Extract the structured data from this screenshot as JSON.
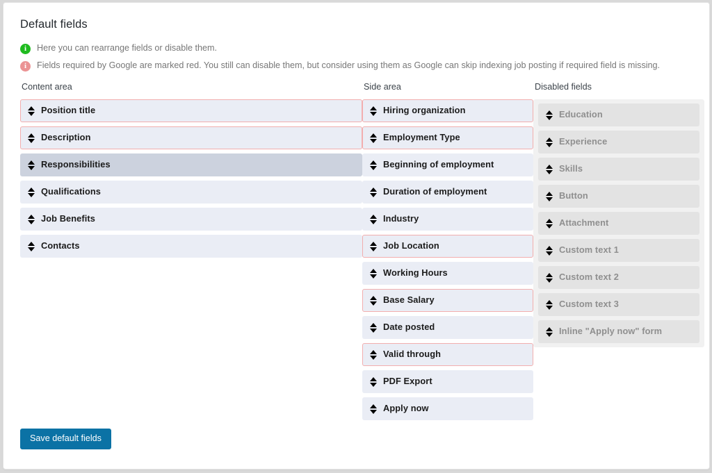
{
  "page": {
    "title": "Default fields"
  },
  "notices": [
    {
      "icon": "info-icon-green",
      "tone": "green",
      "glyph": "i",
      "text": "Here you can rearrange fields or disable them."
    },
    {
      "icon": "info-icon-red",
      "tone": "red",
      "glyph": "i",
      "text": "Fields required by Google are marked red. You still can disable them, but consider using them as Google can skip indexing job posting if required field is missing."
    }
  ],
  "columns": {
    "content": {
      "heading": "Content area",
      "items": [
        {
          "label": "Position title",
          "required": true,
          "active": false
        },
        {
          "label": "Description",
          "required": true,
          "active": false
        },
        {
          "label": "Responsibilities",
          "required": false,
          "active": true
        },
        {
          "label": "Qualifications",
          "required": false,
          "active": false
        },
        {
          "label": "Job Benefits",
          "required": false,
          "active": false
        },
        {
          "label": "Contacts",
          "required": false,
          "active": false
        }
      ]
    },
    "side": {
      "heading": "Side area",
      "items": [
        {
          "label": "Hiring organization",
          "required": true,
          "active": false
        },
        {
          "label": "Employment Type",
          "required": true,
          "active": false
        },
        {
          "label": "Beginning of employment",
          "required": false,
          "active": false
        },
        {
          "label": "Duration of employment",
          "required": false,
          "active": false
        },
        {
          "label": "Industry",
          "required": false,
          "active": false
        },
        {
          "label": "Job Location",
          "required": true,
          "active": false
        },
        {
          "label": "Working Hours",
          "required": false,
          "active": false
        },
        {
          "label": "Base Salary",
          "required": true,
          "active": false
        },
        {
          "label": "Date posted",
          "required": false,
          "active": false
        },
        {
          "label": "Valid through",
          "required": true,
          "active": false
        },
        {
          "label": "PDF Export",
          "required": false,
          "active": false
        },
        {
          "label": "Apply now",
          "required": false,
          "active": false
        }
      ]
    },
    "disabled": {
      "heading": "Disabled fields",
      "items": [
        {
          "label": "Education"
        },
        {
          "label": "Experience"
        },
        {
          "label": "Skills"
        },
        {
          "label": "Button"
        },
        {
          "label": "Attachment"
        },
        {
          "label": "Custom text 1"
        },
        {
          "label": "Custom text 2"
        },
        {
          "label": "Custom text 3"
        },
        {
          "label": "Inline \"Apply now\" form"
        }
      ]
    }
  },
  "actions": {
    "save_label": "Save default fields"
  },
  "colors": {
    "accent": "#0b72a5",
    "required_border": "#f2aeae",
    "item_bg": "#eaedf5",
    "active_bg": "#ccd2de",
    "disabled_panel": "#f1f1f1",
    "disabled_item": "#e3e3e3",
    "notice_green": "#1fbb1f",
    "notice_red": "#eb9394"
  }
}
